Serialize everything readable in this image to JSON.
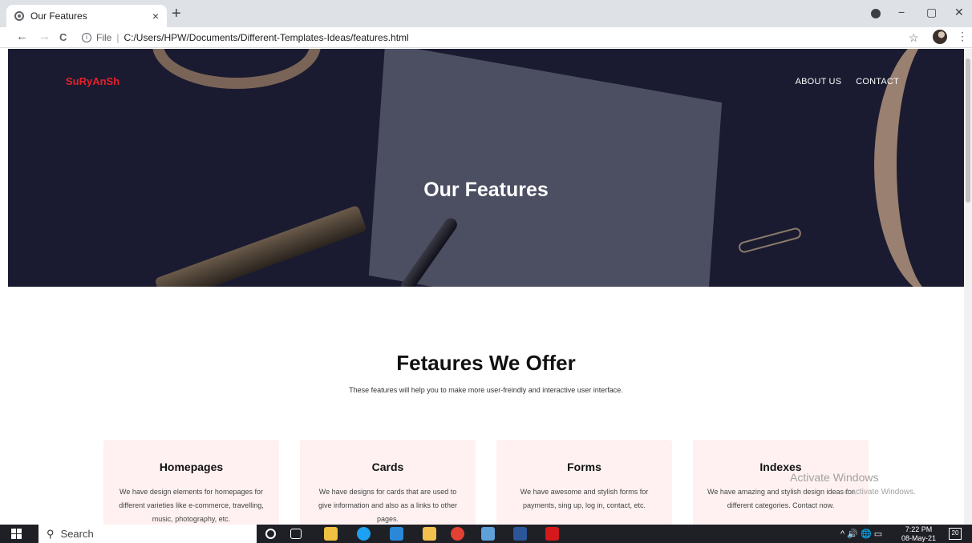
{
  "browser": {
    "tab_title": "Our Features",
    "tab_close": "×",
    "new_tab": "+",
    "url_prefix": "File",
    "url_sep": "|",
    "url": "C:/Users/HPW/Documents/Different-Templates-Ideas/features.html",
    "back": "←",
    "forward": "→",
    "reload": "C",
    "star": "☆",
    "menu": "⋮",
    "min": "−",
    "max": "▢",
    "close": "✕"
  },
  "header": {
    "brand": "SuRyAnSh",
    "nav": [
      "ABOUT US",
      "CONTACT"
    ],
    "hero_title": "Our Features"
  },
  "features": {
    "title": "Fetaures We Offer",
    "subtitle": "These features will help you to make more user-freindly and interactive user interface.",
    "cards": [
      {
        "title": "Homepages",
        "text": "We have design elements for homepages for different varieties like e-commerce, travelling, music, photography, etc."
      },
      {
        "title": "Cards",
        "text": "We have designs for cards that are used to give information and also as a links to other pages."
      },
      {
        "title": "Forms",
        "text": "We have awesome and stylish forms for payments, sing up, log in, contact, etc."
      },
      {
        "title": "Indexes",
        "text": "We have amazing and stylish design ideas for different categories. Contact now."
      }
    ]
  },
  "watermark": {
    "line1": "Activate Windows",
    "line2": "o activate Windows."
  },
  "taskbar": {
    "search_placeholder": "Search",
    "tray": "^ 🔊 🌐 ▭",
    "time": "7:22 PM",
    "date": "08-May-21",
    "notifications": "20"
  },
  "colors": {
    "brand": "#e8202a",
    "hero_bg": "#1a1b30",
    "card_bg": "#fff1f1"
  }
}
